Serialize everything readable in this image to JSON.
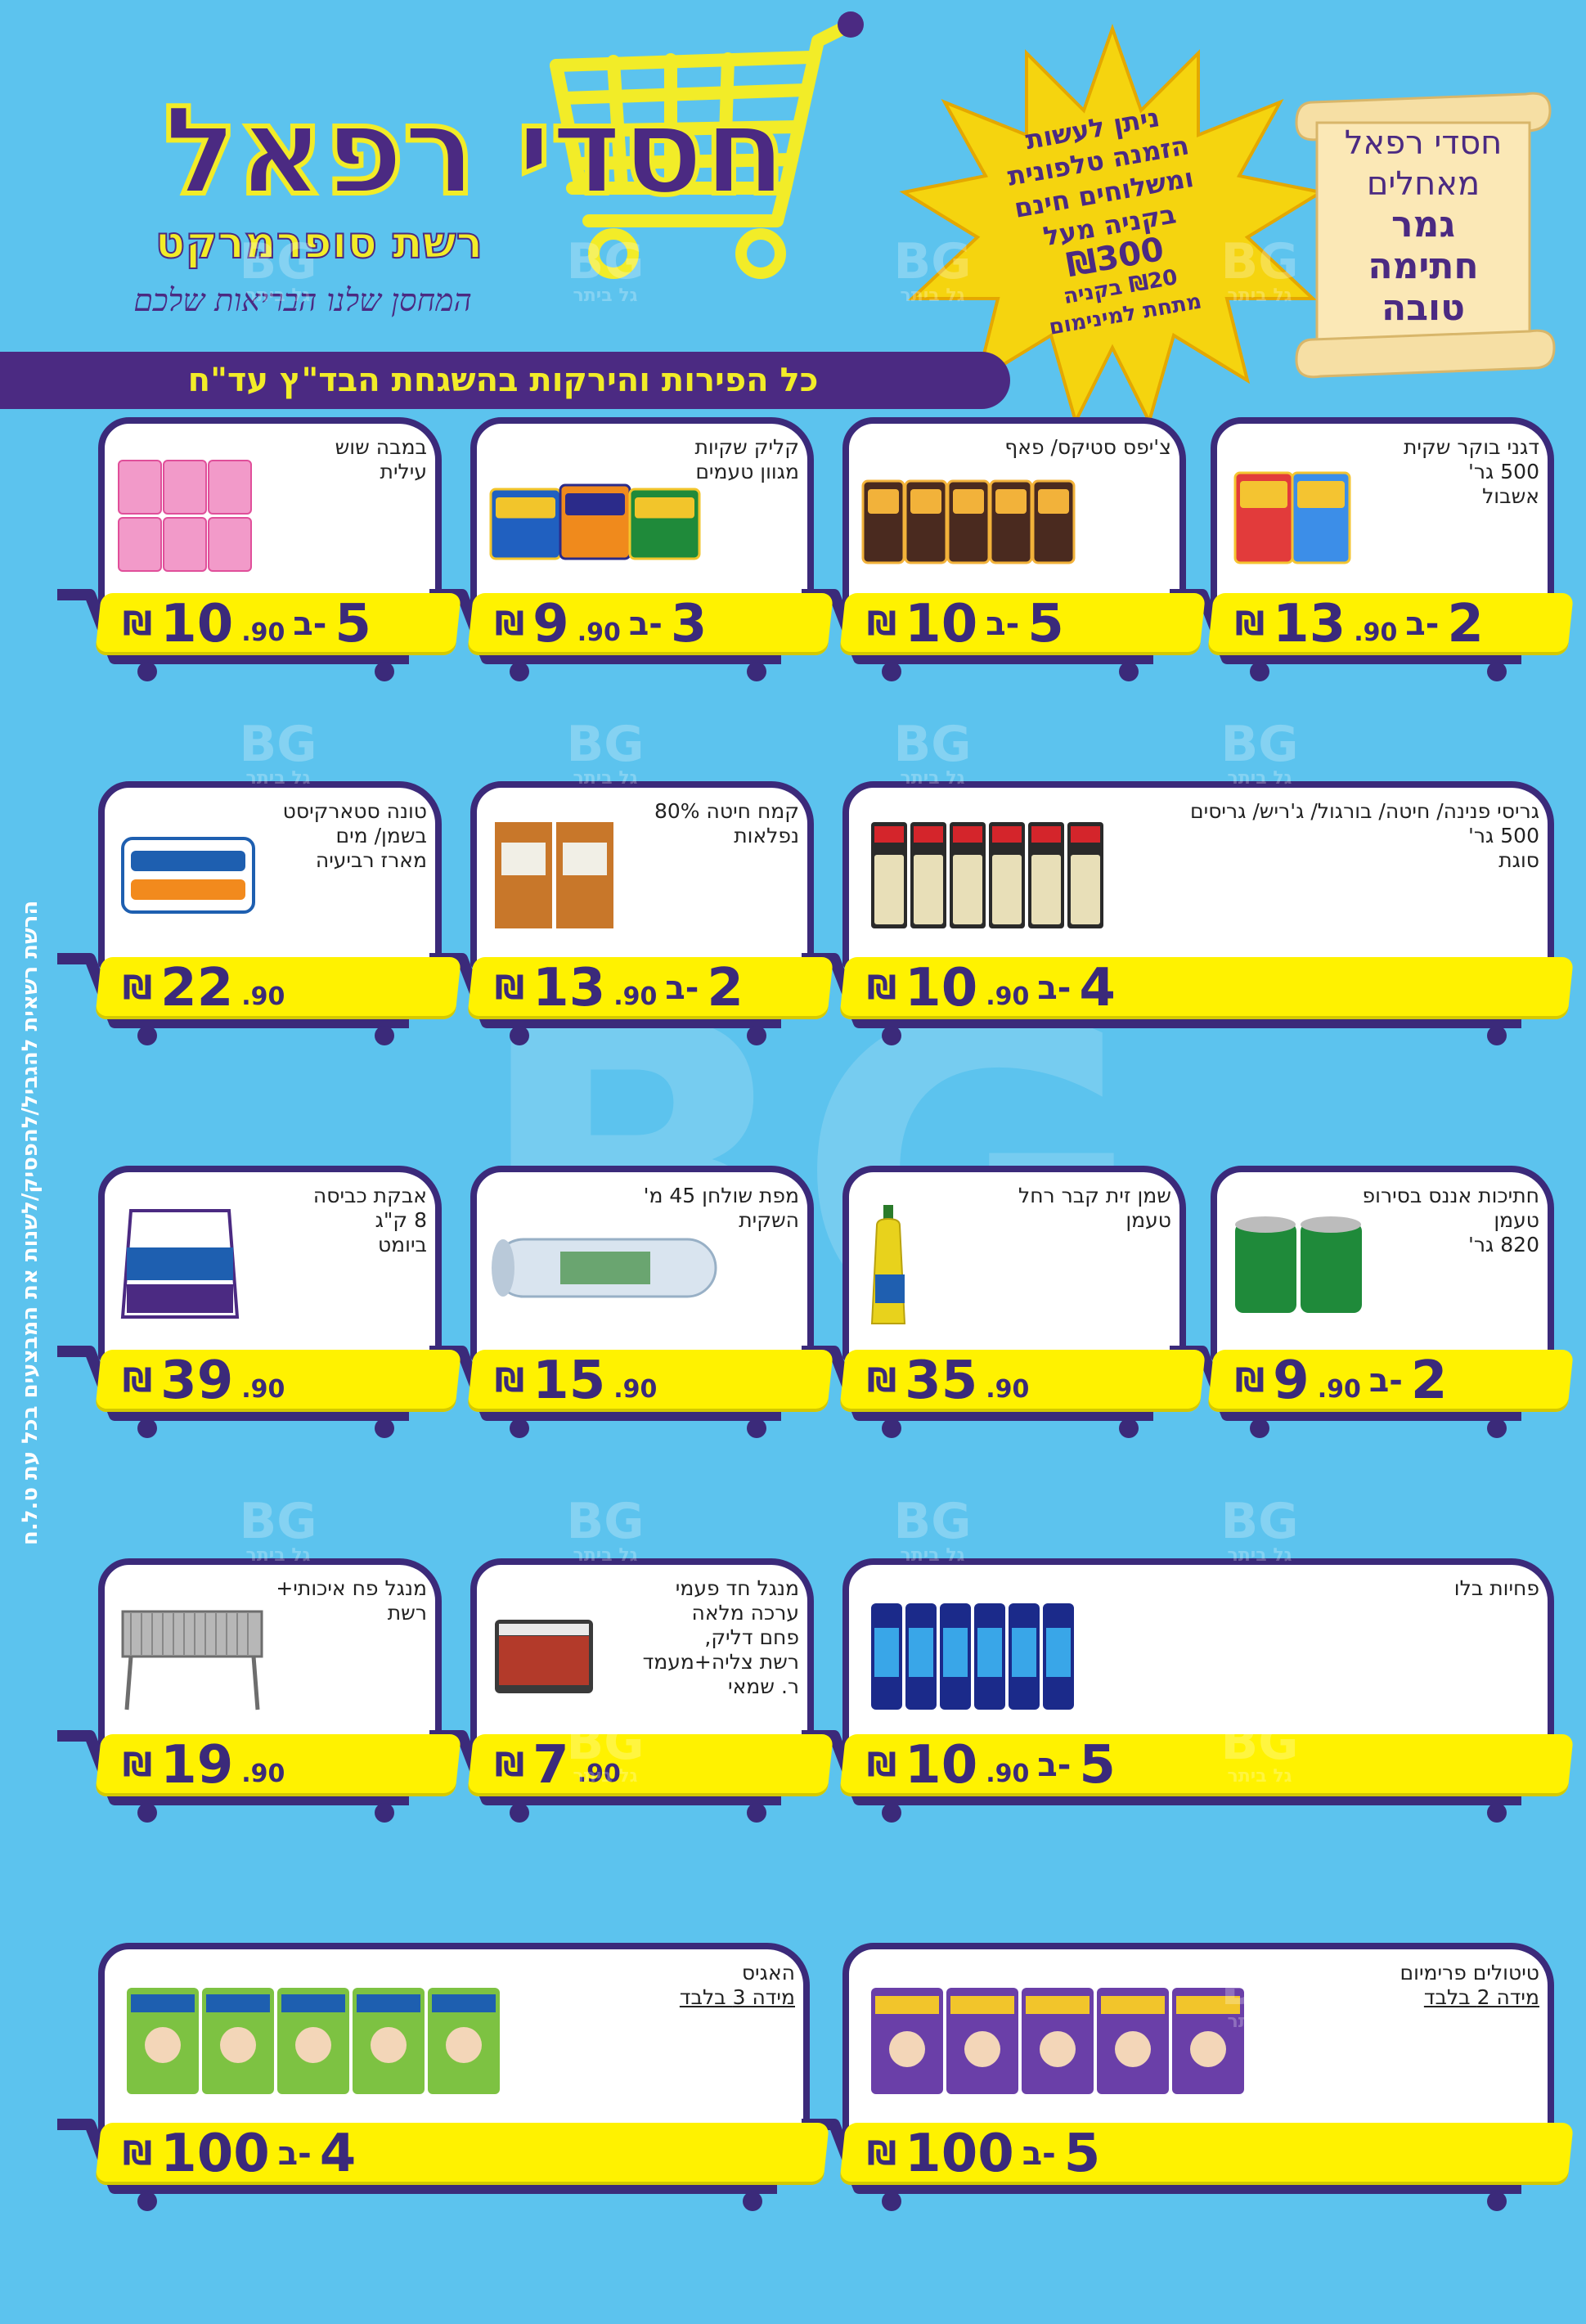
{
  "header": {
    "store_name": "חסדי רפאל",
    "store_sub": "רשת סופרמרקט",
    "slogan": "המחסן שלנו הבריאות שלכם",
    "star_lines": [
      "ניתן לעשות",
      "הזמנה טלפונית",
      "ומשלוחים חינם",
      "בקניה מעל",
      "₪300"
    ],
    "star_small_lines": [
      "₪20 בקניה",
      "מתחת למינימום"
    ],
    "scroll_lines": [
      "חסדי רפאל",
      "מאחלים"
    ],
    "scroll_bold_lines": [
      "גמר",
      "חתימה",
      "טובה"
    ],
    "banner": "כל הפירות והירקות בהשגחת הבד\"ץ עד\"ח",
    "side_note": "הרשת רשאית להגביל/להפסיק/לשנות את המבצעים בכל עת ט.ל.ח"
  },
  "watermark": {
    "mark": "BG",
    "caption": "גל ביתר",
    "big": "BG"
  },
  "products": [
    {
      "title": [
        "דגני בוקר שקית",
        "500 גר'",
        "אשבול"
      ],
      "qty": "2",
      "be": "ב-",
      "price_main": "13",
      "price_cents": ".90",
      "shekel": "₪"
    },
    {
      "title": [
        "צ'יפס סטיקס/ פאף"
      ],
      "qty": "5",
      "be": "ב-",
      "price_main": "10",
      "price_cents": "",
      "shekel": "₪"
    },
    {
      "title": [
        "קליק שקיות",
        "מגוון טעמים"
      ],
      "qty": "3",
      "be": "ב-",
      "price_main": "9",
      "price_cents": ".90",
      "shekel": "₪"
    },
    {
      "title": [
        "במבה שוש",
        "עילית"
      ],
      "qty": "5",
      "be": "ב-",
      "price_main": "10",
      "price_cents": ".90",
      "shekel": "₪"
    },
    {
      "title": [
        "גריסי פנינה/ חיטה/ בורגול/ ג'ריש/ גריסים",
        "500 גר'",
        "סוגת"
      ],
      "qty": "4",
      "be": "ב-",
      "price_main": "10",
      "price_cents": ".90",
      "shekel": "₪"
    },
    {
      "title": [
        "קמח חיטה 80%",
        "נפלאות"
      ],
      "qty": "2",
      "be": "ב-",
      "price_main": "13",
      "price_cents": ".90",
      "shekel": "₪"
    },
    {
      "title": [
        "טונה סטארקיסט",
        "בשמן/ מים",
        "מארז רביעיה"
      ],
      "qty": "",
      "be": "",
      "price_main": "22",
      "price_cents": ".90",
      "shekel": "₪"
    },
    {
      "title": [
        "חתיכות אננס בסירופ",
        "טעמן",
        "820 גר'"
      ],
      "qty": "2",
      "be": "ב-",
      "price_main": "9",
      "price_cents": ".90",
      "shekel": "₪"
    },
    {
      "title": [
        "שמן זית קבר רחל",
        "טעמן"
      ],
      "qty": "",
      "be": "",
      "price_main": "35",
      "price_cents": ".90",
      "shekel": "₪"
    },
    {
      "title": [
        "מפת שולחן 45 מ'",
        "השקית"
      ],
      "qty": "",
      "be": "",
      "price_main": "15",
      "price_cents": ".90",
      "shekel": "₪"
    },
    {
      "title": [
        "אבקת כביסה",
        "8 ק\"ג",
        "ביומט"
      ],
      "qty": "",
      "be": "",
      "price_main": "39",
      "price_cents": ".90",
      "shekel": "₪"
    },
    {
      "title": [
        "פחיות בלו"
      ],
      "qty": "5",
      "be": "ב-",
      "price_main": "10",
      "price_cents": ".90",
      "shekel": "₪"
    },
    {
      "title": [
        "מנגל חד פעמי",
        "ערכה מלאה",
        "פחם דליק,",
        "רשת צליה+מעמד",
        "ר. שמאי"
      ],
      "qty": "",
      "be": "",
      "price_main": "7",
      "price_cents": ".90",
      "shekel": "₪"
    },
    {
      "title": [
        "מנגל פח איכותי+ רשת"
      ],
      "qty": "",
      "be": "",
      "price_main": "19",
      "price_cents": ".90",
      "shekel": "₪"
    },
    {
      "title": [
        "טיטולים פרימיום",
        "מידה 2 בלבד"
      ],
      "qty": "5",
      "be": "ב-",
      "price_main": "100",
      "price_cents": "",
      "shekel": "₪"
    },
    {
      "title": [
        "האגיס",
        "מידה 3 בלבד"
      ],
      "qty": "4",
      "be": "ב-",
      "price_main": "100",
      "price_cents": "",
      "shekel": "₪"
    }
  ],
  "stamp_text": "בהשגחת הבד\"ץ",
  "colors": {
    "background": "#5cc3ee",
    "purple": "#3b2a7a",
    "yellow": "#fff200",
    "brand_purple": "#4b2a82"
  }
}
